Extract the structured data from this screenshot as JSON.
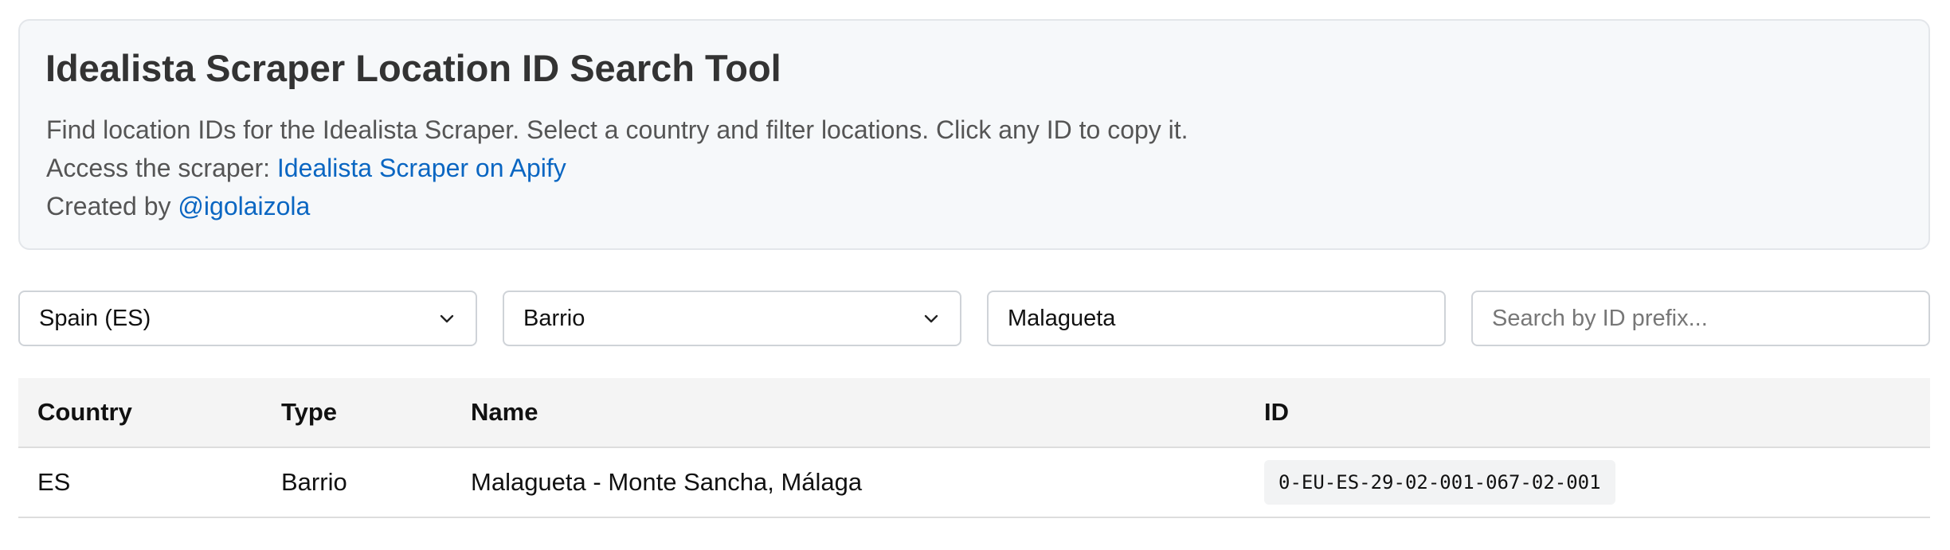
{
  "header": {
    "title": "Idealista Scraper Location ID Search Tool",
    "description": "Find location IDs for the Idealista Scraper. Select a country and filter locations. Click any ID to copy it.",
    "access_prefix": "Access the scraper: ",
    "access_link": "Idealista Scraper on Apify",
    "created_prefix": "Created by ",
    "created_link": "@igolaizola"
  },
  "filters": {
    "country": "Spain (ES)",
    "type": "Barrio",
    "name_value": "Malagueta",
    "id_placeholder": "Search by ID prefix..."
  },
  "table": {
    "headers": [
      "Country",
      "Type",
      "Name",
      "ID"
    ],
    "rows": [
      {
        "country": "ES",
        "type": "Barrio",
        "name": "Malagueta - Monte Sancha, Málaga",
        "id": "0-EU-ES-29-02-001-067-02-001"
      }
    ]
  },
  "colors": {
    "link": "#0a66c2",
    "card_background": "#f6f8fa",
    "table_header_background": "#f4f4f4"
  },
  "icons": {
    "select_arrow": "chevron-down-icon"
  }
}
